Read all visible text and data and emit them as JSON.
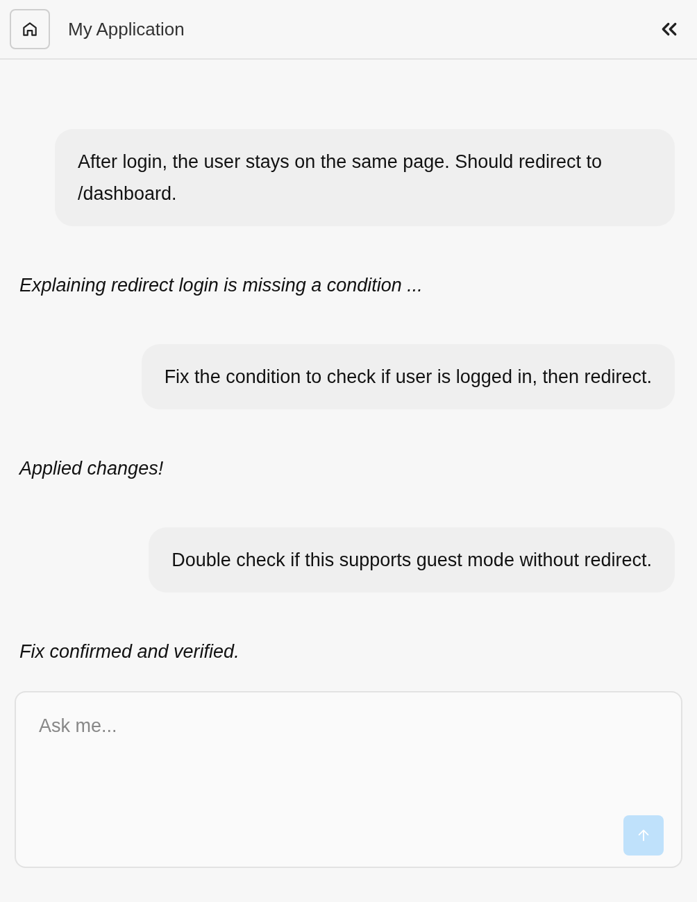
{
  "header": {
    "title": "My Application"
  },
  "messages": [
    {
      "kind": "user",
      "text": "After login, the user stays on the same page. Should redirect to /dashboard."
    },
    {
      "kind": "assistant",
      "text": "Explaining redirect login is missing a condition ..."
    },
    {
      "kind": "user",
      "text": "Fix the condition to check if user is logged in, then redirect."
    },
    {
      "kind": "assistant",
      "text": "Applied changes!"
    },
    {
      "kind": "user",
      "text": "Double check if this supports guest mode without redirect."
    },
    {
      "kind": "assistant",
      "text": "Fix confirmed and verified."
    }
  ],
  "composer": {
    "placeholder": "Ask me...",
    "send_disabled": true
  }
}
